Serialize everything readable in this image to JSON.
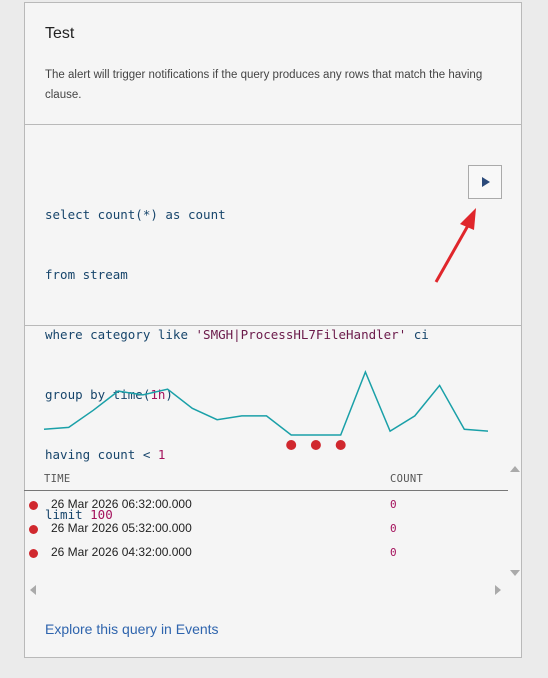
{
  "header": {
    "title": "Test",
    "description": "The alert will trigger notifications if the query produces any rows that match the having clause."
  },
  "query": {
    "line1": "select count(*) as count",
    "line2": "from stream",
    "line3_prefix": "where category like ",
    "line3_string": "'SMGH|ProcessHL7FileHandler'",
    "line3_suffix": " ci",
    "line4_prefix": "group by time(",
    "line4_num": "1h",
    "line4_suffix": ")",
    "line5_prefix": "having count < ",
    "line5_num": "1",
    "line6_prefix": "limit ",
    "line6_num": "100",
    "run_button_icon": "play-icon"
  },
  "chart_data": {
    "type": "line",
    "series": [
      {
        "values": [
          3,
          4,
          13,
          23,
          21,
          24,
          14,
          8,
          10,
          10,
          0,
          0,
          0,
          33,
          2,
          10,
          26,
          3,
          2
        ]
      }
    ],
    "alert_markers": [
      10,
      11,
      12
    ],
    "line_color": "#1aa0a8",
    "marker_color": "#d0282e"
  },
  "table": {
    "headers": {
      "time": "TIME",
      "count": "COUNT"
    },
    "rows": [
      {
        "time": "26 Mar 2026 06:32:00.000",
        "count": "0"
      },
      {
        "time": "26 Mar 2026 05:32:00.000",
        "count": "0"
      },
      {
        "time": "26 Mar 2026 04:32:00.000",
        "count": "0"
      }
    ]
  },
  "footer": {
    "explore_link": "Explore this query in Events"
  }
}
